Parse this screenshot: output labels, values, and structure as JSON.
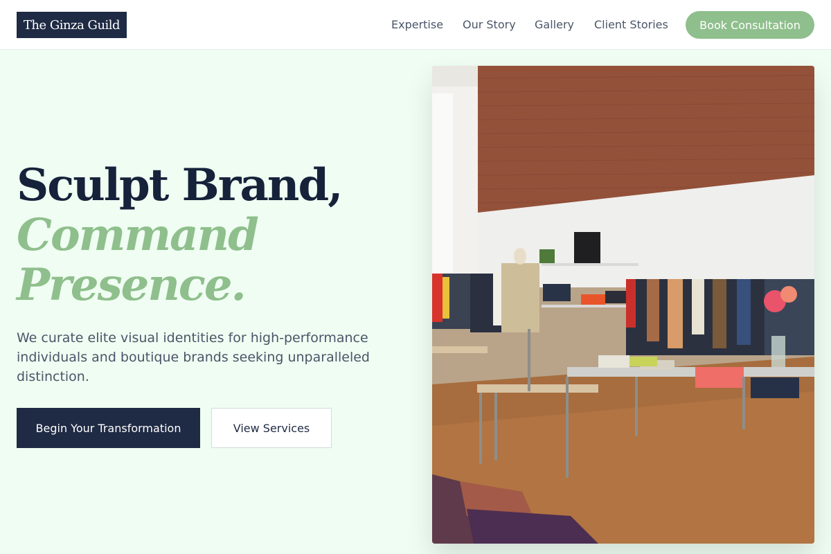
{
  "header": {
    "logo": "The Ginza Guild",
    "nav": [
      "Expertise",
      "Our Story",
      "Gallery",
      "Client Stories"
    ],
    "cta_label": "Book Consultation"
  },
  "hero": {
    "title_line1": "Sculpt Brand,",
    "title_line2": "Command",
    "title_line3": "Presence.",
    "subtitle": "We curate elite visual identities for high-performance individuals and boutique brands seeking unparalleled distinction.",
    "primary_button": "Begin Your Transformation",
    "secondary_button": "View Services",
    "image_alt": "boutique clothing store interior with brick wall and clothing racks"
  },
  "colors": {
    "accent": "#8fbf8c",
    "navy": "#1f2a44",
    "background": "#effdf2"
  }
}
